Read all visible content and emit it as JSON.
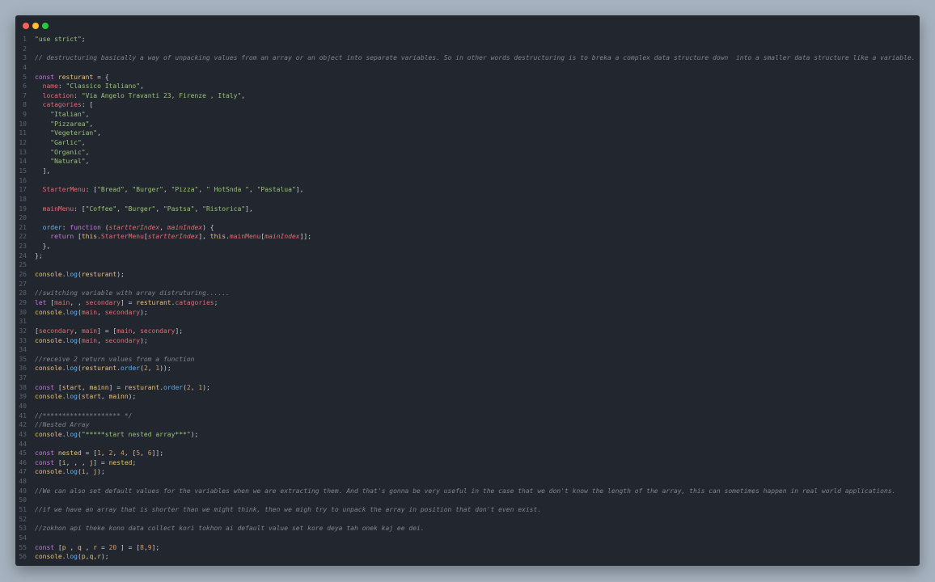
{
  "window": {
    "controls": {
      "close_color": "#ff5f56",
      "minimize_color": "#ffbd2e",
      "maximize_color": "#27c93f"
    }
  },
  "editor": {
    "theme": {
      "background": "#22262e",
      "string": "#98c379",
      "keyword": "#c678dd",
      "comment": "#7f848e",
      "property": "#e06c75",
      "number": "#d19a66",
      "function": "#61afef"
    },
    "lines": [
      [
        [
          "str",
          "\"use strict\""
        ],
        [
          "t",
          ";"
        ]
      ],
      [],
      [
        [
          "cm",
          "// destructuring basically a way of unpacking values from an array or an object into separate variables. So in other words destructuring is to breka a complex data structure down  into a smaller data structure like a variable."
        ]
      ],
      [],
      [
        [
          "kw",
          "const"
        ],
        [
          "t",
          " "
        ],
        [
          "obj",
          "resturant"
        ],
        [
          "t",
          " = {"
        ]
      ],
      [
        [
          "t",
          "  "
        ],
        [
          "prop",
          "name"
        ],
        [
          "t",
          ": "
        ],
        [
          "str",
          "\"Classico Italiano\""
        ],
        [
          "t",
          ","
        ]
      ],
      [
        [
          "t",
          "  "
        ],
        [
          "prop",
          "location"
        ],
        [
          "t",
          ": "
        ],
        [
          "str",
          "\"Via Angelo Travanti 23, Firenze , Italy\""
        ],
        [
          "t",
          ","
        ]
      ],
      [
        [
          "t",
          "  "
        ],
        [
          "prop",
          "catagories"
        ],
        [
          "t",
          ": ["
        ]
      ],
      [
        [
          "t",
          "    "
        ],
        [
          "str",
          "\"Italian\""
        ],
        [
          "t",
          ","
        ]
      ],
      [
        [
          "t",
          "    "
        ],
        [
          "str",
          "\"Pizzarea\""
        ],
        [
          "t",
          ","
        ]
      ],
      [
        [
          "t",
          "    "
        ],
        [
          "str",
          "\"Vegeterian\""
        ],
        [
          "t",
          ","
        ]
      ],
      [
        [
          "t",
          "    "
        ],
        [
          "str",
          "\"Garlic\""
        ],
        [
          "t",
          ","
        ]
      ],
      [
        [
          "t",
          "    "
        ],
        [
          "str",
          "\"Organic\""
        ],
        [
          "t",
          ","
        ]
      ],
      [
        [
          "t",
          "    "
        ],
        [
          "str",
          "\"Natural\""
        ],
        [
          "t",
          ","
        ]
      ],
      [
        [
          "t",
          "  ],"
        ]
      ],
      [],
      [
        [
          "t",
          "  "
        ],
        [
          "prop",
          "StarterMenu"
        ],
        [
          "t",
          ": ["
        ],
        [
          "str",
          "\"Bread\""
        ],
        [
          "t",
          ", "
        ],
        [
          "str",
          "\"Burger\""
        ],
        [
          "t",
          ", "
        ],
        [
          "str",
          "\"Pizza\""
        ],
        [
          "t",
          ", "
        ],
        [
          "str",
          "\" HotSnda \""
        ],
        [
          "t",
          ", "
        ],
        [
          "str",
          "\"Pastalua\""
        ],
        [
          "t",
          "],"
        ]
      ],
      [],
      [
        [
          "t",
          "  "
        ],
        [
          "prop",
          "mainMenu"
        ],
        [
          "t",
          ": ["
        ],
        [
          "str",
          "\"Coffee\""
        ],
        [
          "t",
          ", "
        ],
        [
          "str",
          "\"Burger\""
        ],
        [
          "t",
          ", "
        ],
        [
          "str",
          "\"Pastsa\""
        ],
        [
          "t",
          ", "
        ],
        [
          "str",
          "\"Ristorica\""
        ],
        [
          "t",
          "],"
        ]
      ],
      [],
      [
        [
          "t",
          "  "
        ],
        [
          "fn",
          "order"
        ],
        [
          "t",
          ": "
        ],
        [
          "kw",
          "function"
        ],
        [
          "t",
          " ("
        ],
        [
          "param",
          "startterIndex"
        ],
        [
          "t",
          ", "
        ],
        [
          "param",
          "mainIndex"
        ],
        [
          "t",
          ") {"
        ]
      ],
      [
        [
          "t",
          "    "
        ],
        [
          "kw",
          "return"
        ],
        [
          "t",
          " ["
        ],
        [
          "obj",
          "this"
        ],
        [
          "t",
          "."
        ],
        [
          "prop",
          "StarterMenu"
        ],
        [
          "t",
          "["
        ],
        [
          "param",
          "startterIndex"
        ],
        [
          "t",
          "], "
        ],
        [
          "obj",
          "this"
        ],
        [
          "t",
          "."
        ],
        [
          "prop",
          "mainMenu"
        ],
        [
          "t",
          "["
        ],
        [
          "param",
          "mainIndex"
        ],
        [
          "t",
          "]];"
        ]
      ],
      [
        [
          "t",
          "  },"
        ]
      ],
      [
        [
          "t",
          "};"
        ]
      ],
      [],
      [
        [
          "obj",
          "console"
        ],
        [
          "t",
          "."
        ],
        [
          "fn",
          "log"
        ],
        [
          "t",
          "("
        ],
        [
          "obj",
          "resturant"
        ],
        [
          "t",
          ");"
        ]
      ],
      [],
      [
        [
          "cm",
          "//switching variable with array distruturing......"
        ]
      ],
      [
        [
          "kw",
          "let"
        ],
        [
          "t",
          " ["
        ],
        [
          "prop",
          "main"
        ],
        [
          "t",
          ", , "
        ],
        [
          "prop",
          "secondary"
        ],
        [
          "t",
          "] = "
        ],
        [
          "obj",
          "resturant"
        ],
        [
          "t",
          "."
        ],
        [
          "prop",
          "catagories"
        ],
        [
          "t",
          ";"
        ]
      ],
      [
        [
          "obj",
          "console"
        ],
        [
          "t",
          "."
        ],
        [
          "fn",
          "log"
        ],
        [
          "t",
          "("
        ],
        [
          "prop",
          "main"
        ],
        [
          "t",
          ", "
        ],
        [
          "prop",
          "secondary"
        ],
        [
          "t",
          ");"
        ]
      ],
      [],
      [
        [
          "t",
          "["
        ],
        [
          "prop",
          "secondary"
        ],
        [
          "t",
          ", "
        ],
        [
          "prop",
          "main"
        ],
        [
          "t",
          "] = ["
        ],
        [
          "prop",
          "main"
        ],
        [
          "t",
          ", "
        ],
        [
          "prop",
          "secondary"
        ],
        [
          "t",
          "];"
        ]
      ],
      [
        [
          "obj",
          "console"
        ],
        [
          "t",
          "."
        ],
        [
          "fn",
          "log"
        ],
        [
          "t",
          "("
        ],
        [
          "prop",
          "main"
        ],
        [
          "t",
          ", "
        ],
        [
          "prop",
          "secondary"
        ],
        [
          "t",
          ");"
        ]
      ],
      [],
      [
        [
          "cm",
          "//receive 2 return values from a function"
        ]
      ],
      [
        [
          "obj",
          "console"
        ],
        [
          "t",
          "."
        ],
        [
          "fn",
          "log"
        ],
        [
          "t",
          "("
        ],
        [
          "obj",
          "resturant"
        ],
        [
          "t",
          "."
        ],
        [
          "fn",
          "order"
        ],
        [
          "t",
          "("
        ],
        [
          "num",
          "2"
        ],
        [
          "t",
          ", "
        ],
        [
          "num",
          "1"
        ],
        [
          "t",
          "));"
        ]
      ],
      [],
      [
        [
          "kw",
          "const"
        ],
        [
          "t",
          " ["
        ],
        [
          "obj",
          "start"
        ],
        [
          "t",
          ", "
        ],
        [
          "obj",
          "mainn"
        ],
        [
          "t",
          "] = "
        ],
        [
          "obj",
          "resturant"
        ],
        [
          "t",
          "."
        ],
        [
          "fn",
          "order"
        ],
        [
          "t",
          "("
        ],
        [
          "num",
          "2"
        ],
        [
          "t",
          ", "
        ],
        [
          "num",
          "1"
        ],
        [
          "t",
          ");"
        ]
      ],
      [
        [
          "obj",
          "console"
        ],
        [
          "t",
          "."
        ],
        [
          "fn",
          "log"
        ],
        [
          "t",
          "("
        ],
        [
          "obj",
          "start"
        ],
        [
          "t",
          ", "
        ],
        [
          "obj",
          "mainn"
        ],
        [
          "t",
          ");"
        ]
      ],
      [],
      [
        [
          "cm",
          "//******************** */"
        ]
      ],
      [
        [
          "cm",
          "//Nested Array"
        ]
      ],
      [
        [
          "obj",
          "console"
        ],
        [
          "t",
          "."
        ],
        [
          "fn",
          "log"
        ],
        [
          "t",
          "("
        ],
        [
          "str",
          "\"*****start nested array***\""
        ],
        [
          "t",
          ");"
        ]
      ],
      [],
      [
        [
          "kw",
          "const"
        ],
        [
          "t",
          " "
        ],
        [
          "obj",
          "nested"
        ],
        [
          "t",
          " = ["
        ],
        [
          "num",
          "1"
        ],
        [
          "t",
          ", "
        ],
        [
          "num",
          "2"
        ],
        [
          "t",
          ", "
        ],
        [
          "num",
          "4"
        ],
        [
          "t",
          ", ["
        ],
        [
          "num",
          "5"
        ],
        [
          "t",
          ", "
        ],
        [
          "num",
          "6"
        ],
        [
          "t",
          "]];"
        ]
      ],
      [
        [
          "kw",
          "const"
        ],
        [
          "t",
          " ["
        ],
        [
          "obj",
          "i"
        ],
        [
          "t",
          ", , , "
        ],
        [
          "obj",
          "j"
        ],
        [
          "t",
          "] = "
        ],
        [
          "obj",
          "nested"
        ],
        [
          "t",
          ";"
        ]
      ],
      [
        [
          "obj",
          "console"
        ],
        [
          "t",
          "."
        ],
        [
          "fn",
          "log"
        ],
        [
          "t",
          "("
        ],
        [
          "obj",
          "i"
        ],
        [
          "t",
          ", "
        ],
        [
          "obj",
          "j"
        ],
        [
          "t",
          ");"
        ]
      ],
      [],
      [
        [
          "cm",
          "//We can also set default values for the variables when we are extracting them. And that's gonna be very useful in the case that we don't know the length of the array, this can sometimes happen in real world applications."
        ]
      ],
      [],
      [
        [
          "cm",
          "//if we have an array that is shorter than we might think, then we migh try to unpack the array in position that don't even exist."
        ]
      ],
      [],
      [
        [
          "cm",
          "//zokhon api theke kono data collect kori tokhon ai default value set kore deya tah onek kaj ee dei."
        ]
      ],
      [],
      [
        [
          "kw",
          "const"
        ],
        [
          "t",
          " ["
        ],
        [
          "obj",
          "p"
        ],
        [
          "t",
          " , "
        ],
        [
          "obj",
          "q"
        ],
        [
          "t",
          " , "
        ],
        [
          "obj",
          "r"
        ],
        [
          "t",
          " = "
        ],
        [
          "num",
          "20"
        ],
        [
          "t",
          " ] = ["
        ],
        [
          "num",
          "8"
        ],
        [
          "t",
          ","
        ],
        [
          "num",
          "9"
        ],
        [
          "t",
          "];"
        ]
      ],
      [
        [
          "obj",
          "console"
        ],
        [
          "t",
          "."
        ],
        [
          "fn",
          "log"
        ],
        [
          "t",
          "("
        ],
        [
          "obj",
          "p"
        ],
        [
          "t",
          ","
        ],
        [
          "obj",
          "q"
        ],
        [
          "t",
          ","
        ],
        [
          "obj",
          "r"
        ],
        [
          "t",
          ");"
        ]
      ]
    ]
  }
}
